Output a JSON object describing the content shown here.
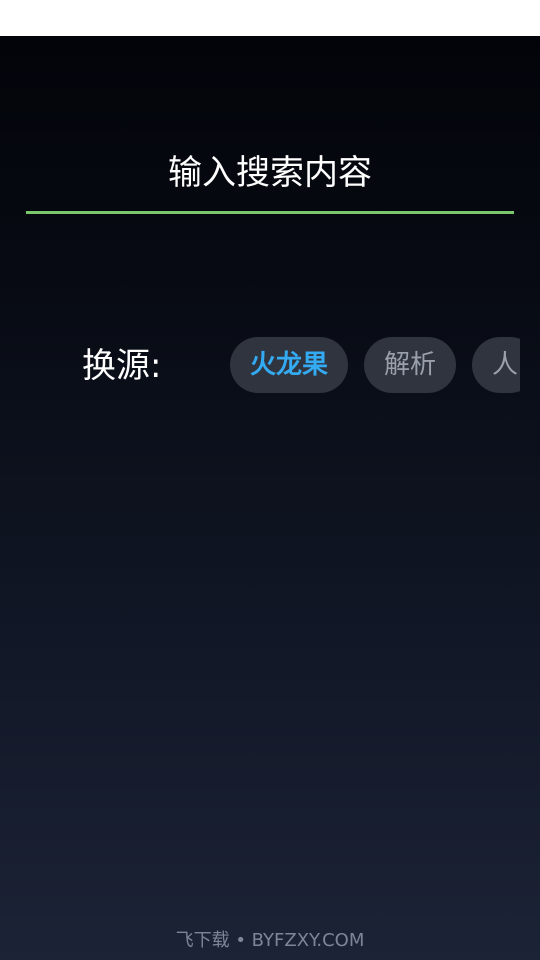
{
  "search": {
    "placeholder": "输入搜索内容",
    "value": ""
  },
  "source": {
    "label": "换源:",
    "chips": [
      {
        "label": "火龙果",
        "active": true
      },
      {
        "label": "解析",
        "active": false
      },
      {
        "label": "人",
        "active": false
      }
    ]
  },
  "watermark": {
    "text": "飞下载 • BYFZXY.COM"
  },
  "colors": {
    "underline": "#7bc86c",
    "active_chip_text": "#33aaf2",
    "chip_bg": "#30343f",
    "chip_text": "#9aa0ab"
  }
}
